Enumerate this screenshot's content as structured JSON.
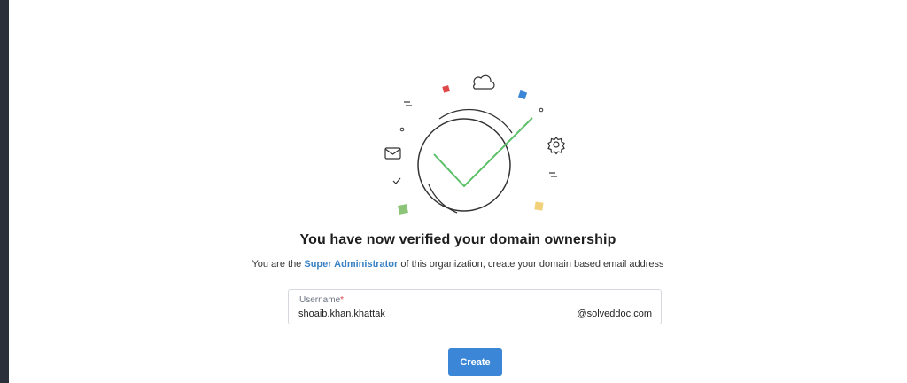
{
  "colors": {
    "accent": "#3b86d6",
    "check": "#5cbf6a",
    "confetti_red": "#e04848",
    "confetti_blue": "#3b86d6",
    "confetti_green": "#8cc47a",
    "confetti_yellow": "#f1d27a"
  },
  "illustration": {
    "icons": [
      "cloud-icon",
      "mail-icon",
      "gear-icon",
      "small-check-icon",
      "large-check-icon"
    ]
  },
  "headline": "You have now verified your domain ownership",
  "subline": {
    "before": "You are the ",
    "role": "Super Administrator",
    "after": " of this organization, create your domain based email address"
  },
  "username_field": {
    "label": "Username",
    "required_mark": "*",
    "value": "shoaib.khan.khattak",
    "domain_suffix": "@solveddoc.com"
  },
  "create_button": {
    "label": "Create"
  }
}
